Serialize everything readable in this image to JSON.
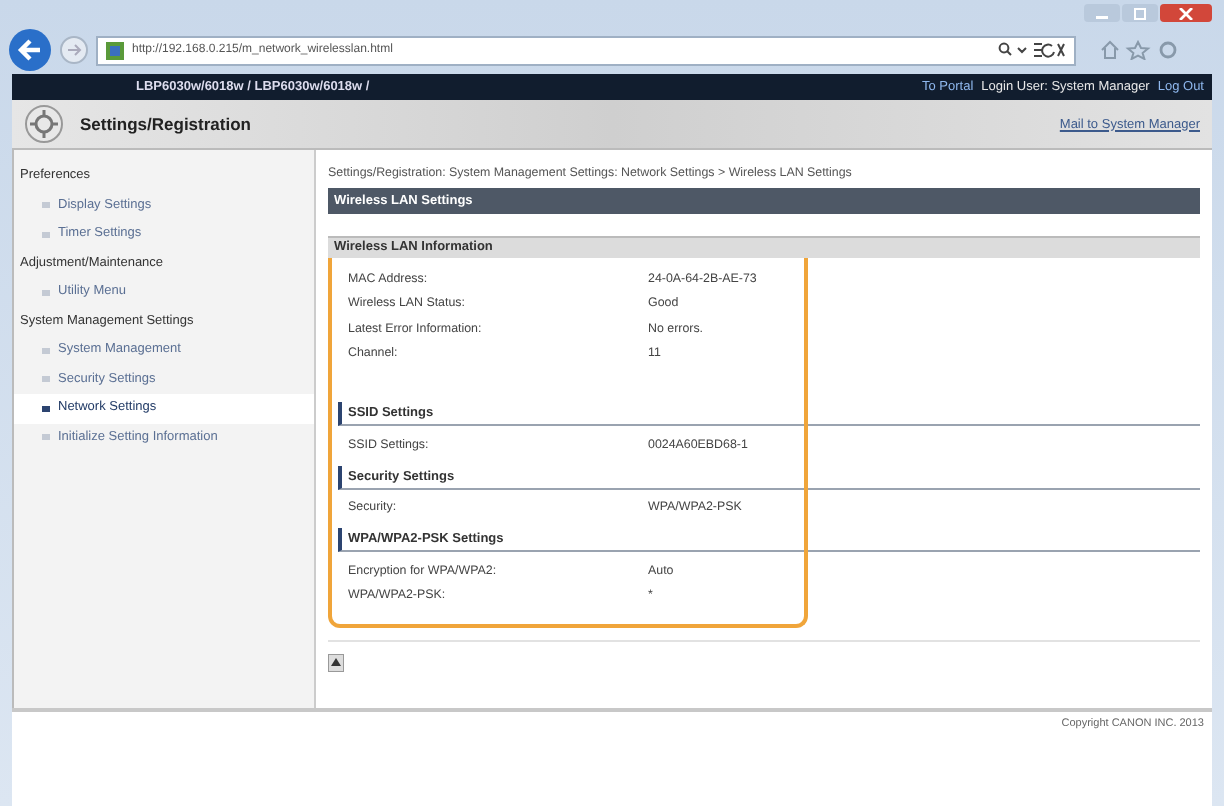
{
  "browser": {
    "url": "http://192.168.0.215/m_network_wirelesslan.html"
  },
  "topbar": {
    "model": "LBP6030w/6018w / LBP6030w/6018w /",
    "links": [
      {
        "label": "To Portal"
      },
      {
        "label": "Login User: System Manager",
        "kind": "text"
      },
      {
        "label": "Log Out"
      }
    ]
  },
  "header": {
    "title": "Settings/Registration",
    "link": "Mail to System Manager"
  },
  "sidebar": {
    "groups": [
      {
        "label": "Preferences",
        "children": [
          {
            "label": "Display Settings",
            "selected": false
          },
          {
            "label": "Timer Settings",
            "selected": false
          }
        ]
      },
      {
        "label": "Adjustment/Maintenance",
        "children": [
          {
            "label": "Utility Menu",
            "selected": false
          }
        ]
      },
      {
        "label": "System Management Settings",
        "children": [
          {
            "label": "System Management",
            "selected": false
          },
          {
            "label": "Security Settings",
            "selected": false
          },
          {
            "label": "Network Settings",
            "selected": true
          },
          {
            "label": "Initialize Setting Information",
            "selected": false
          }
        ]
      }
    ]
  },
  "breadcrumb": "Settings/Registration: System Management Settings: Network Settings > Wireless LAN Settings",
  "page_title": "Wireless LAN Settings",
  "section": {
    "title": "Wireless LAN Information",
    "rows": [
      {
        "label": "MAC Address:",
        "value": "24-0A-64-2B-AE-73"
      },
      {
        "label": "Wireless LAN Status:",
        "value": "Good"
      },
      {
        "label": "Latest Error Information:",
        "value": "No errors."
      },
      {
        "label": "Channel:",
        "value": "11"
      }
    ],
    "subsections": [
      {
        "title": "SSID Settings",
        "rows": [
          {
            "label": "SSID Settings:",
            "value": "0024A60EBD68-1"
          }
        ]
      },
      {
        "title": "Security Settings",
        "rows": [
          {
            "label": "Security:",
            "value": "WPA/WPA2-PSK"
          }
        ]
      },
      {
        "title": "WPA/WPA2-PSK Settings",
        "rows": [
          {
            "label": "Encryption for WPA/WPA2:",
            "value": "Auto"
          },
          {
            "label": "WPA/WPA2-PSK:",
            "value": "*"
          }
        ]
      }
    ]
  },
  "footer": {
    "copyright": "Copyright CANON INC. 2013"
  }
}
